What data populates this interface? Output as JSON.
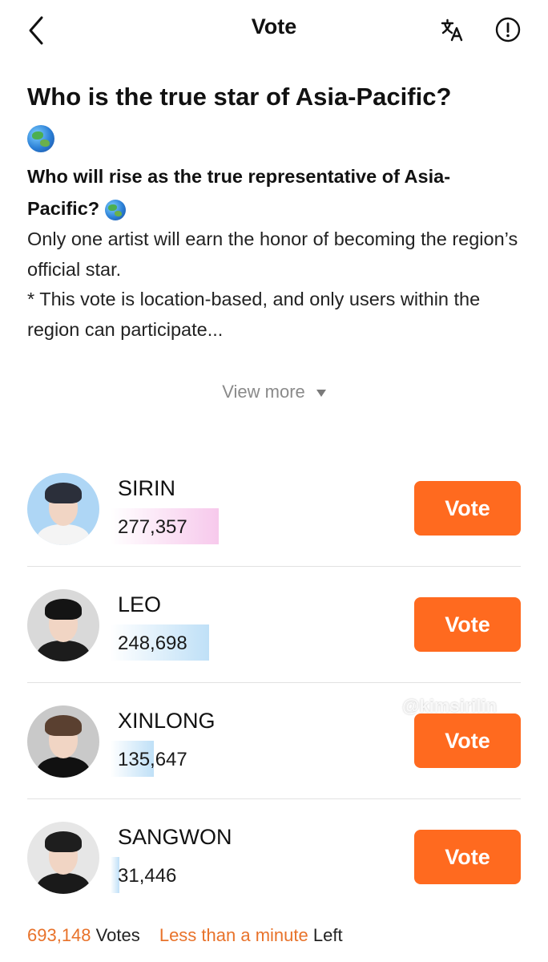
{
  "header": {
    "title": "Vote",
    "back_icon": "chevron-left-icon",
    "translate_icon": "translate-icon",
    "info_icon": "info-icon"
  },
  "poll": {
    "title": "Who is the true star of Asia-Pacific?",
    "subtitle": "Who will rise as the true representative of Asia-Pacific?",
    "description_line1": "Only one artist will earn the honor of becoming the region’s official star.",
    "description_line2": "* This vote is location-based, and only users within the region can participate...",
    "view_more": "View more"
  },
  "candidates": [
    {
      "name": "SIRIN",
      "votes": "277,357",
      "vote_label": "Vote",
      "bar_fraction": 1.0,
      "bar_color": "#f7c9ec"
    },
    {
      "name": "LEO",
      "votes": "248,698",
      "vote_label": "Vote",
      "bar_fraction": 0.91,
      "bar_color": "#bfe0f7"
    },
    {
      "name": "XINLONG",
      "votes": "135,647",
      "vote_label": "Vote",
      "bar_fraction": 0.4,
      "bar_color": "#bfe0f7"
    },
    {
      "name": "SANGWON",
      "votes": "31,446",
      "vote_label": "Vote",
      "bar_fraction": 0.08,
      "bar_color": "#bfe0f7"
    }
  ],
  "footer": {
    "total_votes": "693,148",
    "votes_label": "Votes",
    "time_left": "Less than a minute",
    "left_label": "Left"
  },
  "watermark": "@kimsirilin",
  "colors": {
    "accent": "#ff6a1f",
    "accent_text": "#e8722a"
  }
}
